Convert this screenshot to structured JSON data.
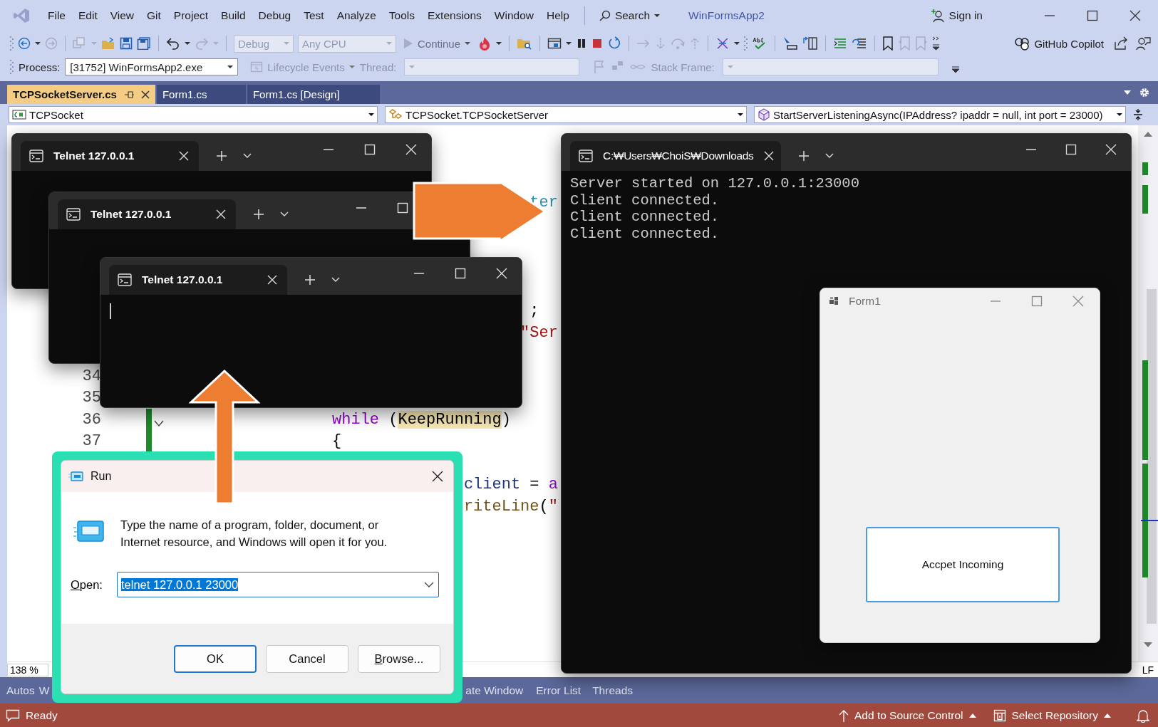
{
  "menu_bar": {
    "items": [
      "File",
      "Edit",
      "View",
      "Git",
      "Project",
      "Build",
      "Debug",
      "Test",
      "Analyze",
      "Tools",
      "Extensions",
      "Window",
      "Help"
    ],
    "search": "Search",
    "solution": "WinFormsApp2",
    "sign_in": "Sign in"
  },
  "toolbar": {
    "configuration": {
      "value": "Debug",
      "disabled": true
    },
    "platform": {
      "value": "Any CPU",
      "disabled": true
    },
    "continue": {
      "label": "Continue",
      "disabled": true
    },
    "copilot": "GitHub Copilot"
  },
  "debug_bar": {
    "process_label": "Process:",
    "process": "[31752] WinFormsApp2.exe",
    "lifecycle": {
      "label": "Lifecycle Events",
      "disabled": true
    },
    "thread_label": {
      "label": "Thread:",
      "disabled": true
    },
    "stack_frame_label": {
      "label": "Stack Frame:",
      "disabled": true
    }
  },
  "tabs": [
    {
      "label": "TCPSocketServer.cs",
      "selected": true
    },
    {
      "label": "Form1.cs",
      "selected": false
    },
    {
      "label": "Form1.cs [Design]",
      "selected": false
    }
  ],
  "nav_bar": {
    "project": "TCPSocket",
    "type": "TCPSocket.TCPSocketServer",
    "member": "StartServerListeningAsync(IPAddress? ipaddr = null, int port = 23000)"
  },
  "editor": {
    "lines": [
      {
        "kind": "line",
        "tokens": [
          {
            "text": "                                    ter",
            "kind": "type"
          }
        ]
      },
      {
        "kind": "blank"
      },
      {
        "kind": "blank"
      },
      {
        "kind": "blank"
      },
      {
        "kind": "blank"
      },
      {
        "kind": "line",
        "tokens": [
          {
            "text": "                                    ;",
            "kind": "plain"
          }
        ]
      },
      {
        "kind": "line",
        "tokens": [
          {
            "text": "                                   \"Ser",
            "kind": "string"
          }
        ]
      },
      {
        "kind": "blank"
      },
      {
        "kind": "line",
        "number": "34"
      },
      {
        "kind": "line",
        "number": "35"
      },
      {
        "kind": "line",
        "number": "36",
        "changed": true,
        "collapsible": true,
        "tokens": [
          {
            "text": "               while",
            "kind": "keyword"
          },
          {
            "text": " (",
            "kind": "plain"
          },
          {
            "text": "KeepRunning",
            "kind": "highlight"
          },
          {
            "text": ")",
            "kind": "plain"
          }
        ]
      },
      {
        "kind": "line",
        "number": "37",
        "changed": true,
        "tokens": [
          {
            "text": "               {",
            "kind": "plain"
          }
        ]
      },
      {
        "kind": "blank"
      },
      {
        "kind": "line",
        "tokens": [
          {
            "text": "                             client",
            "kind": "local"
          },
          {
            "text": " = ",
            "kind": "plain"
          },
          {
            "text": "a",
            "kind": "keyword"
          }
        ]
      },
      {
        "kind": "line",
        "tokens": [
          {
            "text": "                             riteLine",
            "kind": "method"
          },
          {
            "text": "(",
            "kind": "plain"
          },
          {
            "text": "\"",
            "kind": "string"
          }
        ]
      }
    ],
    "zoom": "138 %",
    "line_ending": "LF"
  },
  "panel_tabs": [
    "Autos",
    "W",
    "ate Window",
    "Error List",
    "Threads"
  ],
  "status_bar": {
    "message": "Ready",
    "source_control": "Add to Source Control",
    "repository": "Select Repository"
  },
  "telnet_windows": [
    {
      "title": "Telnet 127.0.0.1",
      "cursor": false
    },
    {
      "title": "Telnet 127.0.0.1",
      "cursor": false
    },
    {
      "title": "Telnet 127.0.0.1",
      "cursor": true
    }
  ],
  "server_console": {
    "title": "C:₩Users₩ChoiS₩Downloads",
    "output": [
      "Server started on 127.0.0.1:23000",
      "Client connected.",
      "Client connected.",
      "Client connected."
    ]
  },
  "form_window": {
    "title": "Form1",
    "button": "Accpet Incoming"
  },
  "run_dialog": {
    "title": "Run",
    "message": "Type the name of a program, folder, document, or Internet resource, and Windows will open it for you.",
    "open_label": {
      "text": "Open:",
      "mnemonic": true
    },
    "value": "telnet 127.0.0.1 23000",
    "buttons": [
      {
        "label": "OK",
        "default": true,
        "mnemonic": false
      },
      {
        "label": "Cancel",
        "default": false,
        "mnemonic": false
      },
      {
        "label": "Browse...",
        "default": false,
        "mnemonic": true
      }
    ]
  }
}
